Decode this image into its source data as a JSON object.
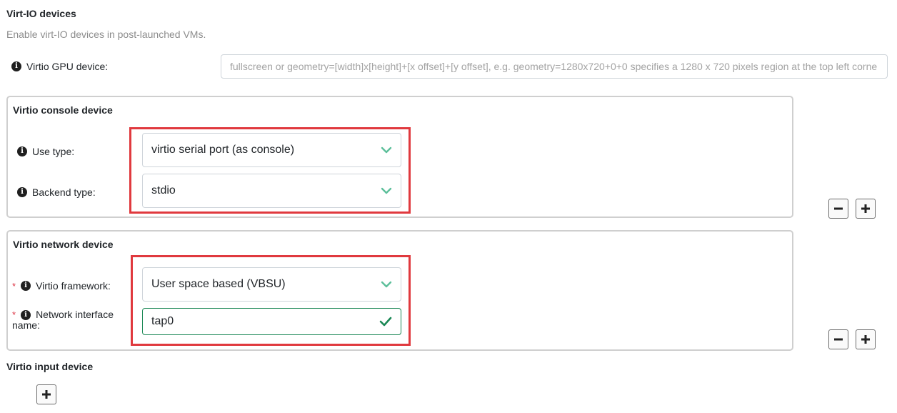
{
  "section": {
    "title": "Virt-IO devices",
    "subtitle": "Enable virt-IO devices in post-launched VMs."
  },
  "gpu": {
    "label": "Virtio GPU device:",
    "placeholder": "fullscreen or geometry=[width]x[height]+[x offset]+[y offset], e.g. geometry=1280x720+0+0 specifies a 1280 x 720 pixels region at the top left corne"
  },
  "console": {
    "title": "Virtio console device",
    "use_type_label": "Use type:",
    "use_type_value": "virtio serial port (as console)",
    "backend_label": "Backend type:",
    "backend_value": "stdio"
  },
  "network": {
    "title": "Virtio network device",
    "framework_label": "Virtio framework:",
    "framework_value": "User space based (VBSU)",
    "iface_label_1": "Network interface",
    "iface_label_2": "name:",
    "iface_value": "tap0",
    "required_mark": "*"
  },
  "input_device": {
    "title": "Virtio input device"
  },
  "icons": {
    "info": "info-icon",
    "chevron": "chevron-down-icon",
    "check": "check-icon",
    "minus": "minus-icon",
    "plus": "plus-icon"
  },
  "colors": {
    "chevron": "#5cbf9a",
    "check": "#198754",
    "highlight": "#e0393e",
    "required": "#dc3545"
  }
}
